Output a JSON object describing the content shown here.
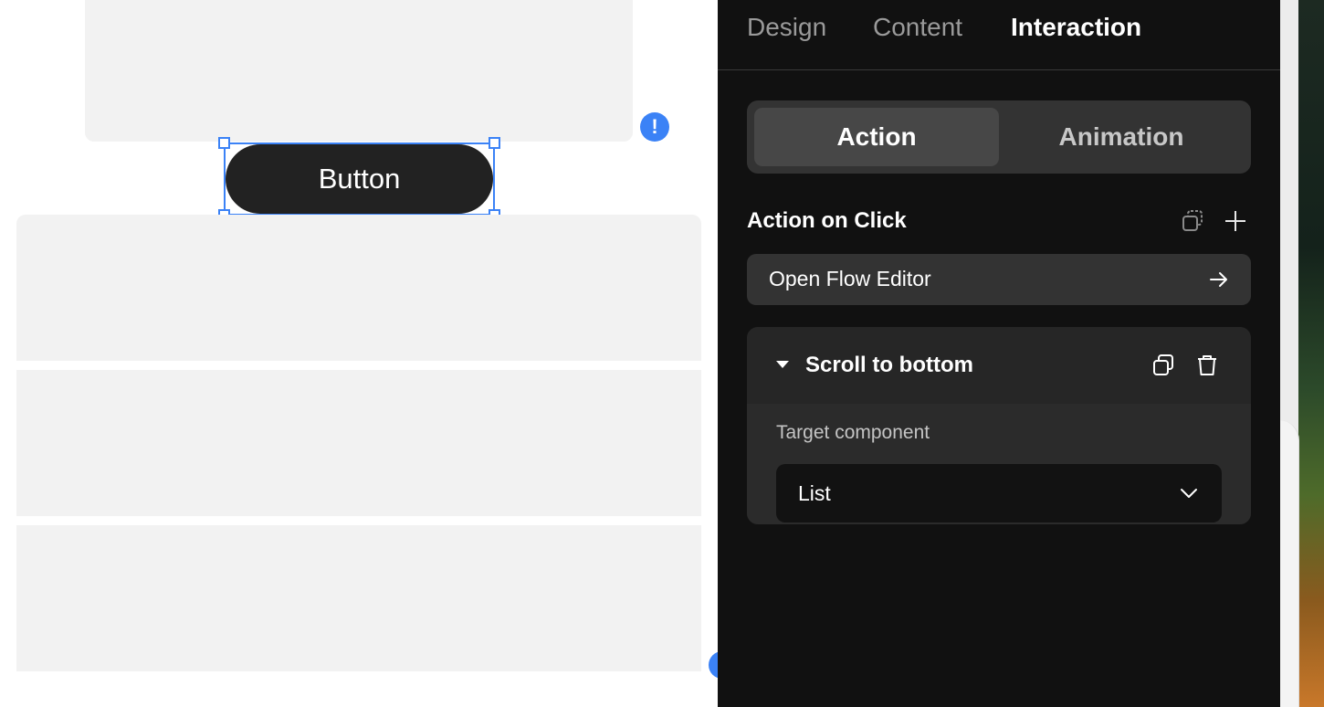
{
  "canvas": {
    "button_label": "Button",
    "warning_badge": "!"
  },
  "panel": {
    "tabs": [
      {
        "label": "Design",
        "active": false
      },
      {
        "label": "Content",
        "active": false
      },
      {
        "label": "Interaction",
        "active": true
      }
    ],
    "segments": [
      {
        "label": "Action",
        "active": true
      },
      {
        "label": "Animation",
        "active": false
      }
    ],
    "section_title": "Action on Click",
    "flow_editor_label": "Open Flow Editor",
    "action_card": {
      "title": "Scroll to bottom",
      "expanded": true,
      "field_label": "Target component",
      "select_value": "List"
    }
  },
  "icons": {
    "warning": "exclamation-icon",
    "copy_actions": "copy-icon",
    "add_action": "plus-icon",
    "open_flow": "arrow-right-icon",
    "collapse": "caret-down-icon",
    "duplicate": "duplicate-icon",
    "delete": "trash-icon",
    "select_chevron": "chevron-down-icon"
  },
  "colors": {
    "accent": "#3b82f6",
    "panel_bg": "#111111",
    "canvas_block": "#f2f2f2",
    "button_bg": "#222222"
  }
}
